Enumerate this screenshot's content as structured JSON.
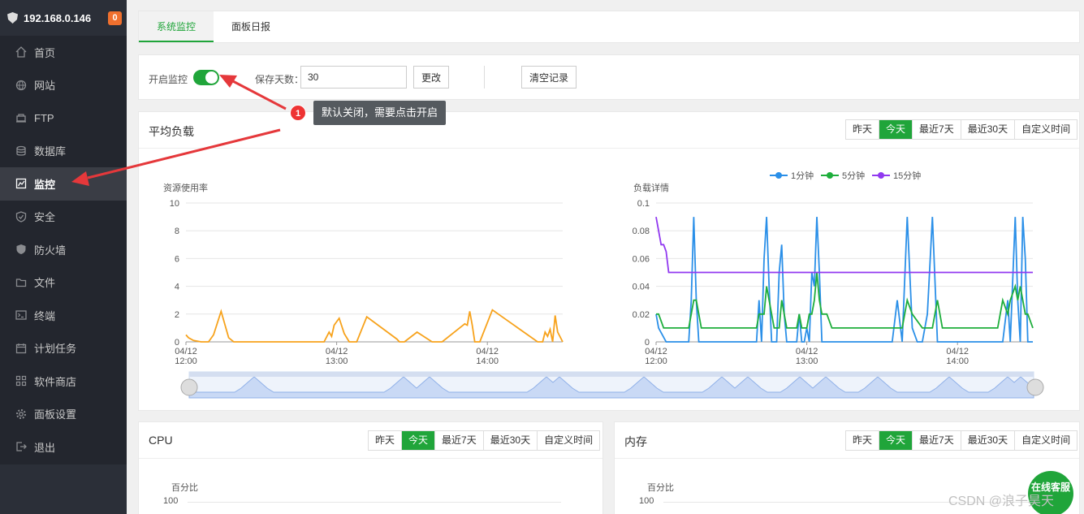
{
  "sidebar": {
    "host": "192.168.0.146",
    "badge": "0",
    "items": [
      {
        "label": "首页",
        "icon": "home-icon"
      },
      {
        "label": "网站",
        "icon": "globe-icon"
      },
      {
        "label": "FTP",
        "icon": "ftp-icon"
      },
      {
        "label": "数据库",
        "icon": "database-icon"
      },
      {
        "label": "监控",
        "icon": "monitor-icon",
        "active": true
      },
      {
        "label": "安全",
        "icon": "shield-check-icon"
      },
      {
        "label": "防火墙",
        "icon": "firewall-icon"
      },
      {
        "label": "文件",
        "icon": "folder-icon"
      },
      {
        "label": "终端",
        "icon": "terminal-icon"
      },
      {
        "label": "计划任务",
        "icon": "calendar-icon"
      },
      {
        "label": "软件商店",
        "icon": "grid-icon"
      },
      {
        "label": "面板设置",
        "icon": "gear-icon"
      },
      {
        "label": "退出",
        "icon": "logout-icon"
      }
    ]
  },
  "tabs": [
    {
      "label": "系统监控",
      "active": true
    },
    {
      "label": "面板日报",
      "active": false
    }
  ],
  "controls": {
    "enable_label": "开启监控",
    "enabled": true,
    "days_label": "保存天数：",
    "days_value": "30",
    "change_button": "更改",
    "clear_button": "清空记录"
  },
  "ranges": [
    "昨天",
    "今天",
    "最近7天",
    "最近30天",
    "自定义时间"
  ],
  "active_range": "今天",
  "load_panel": {
    "title": "平均负载"
  },
  "cpu_panel": {
    "title": "CPU",
    "ylabel": "百分比",
    "ytick": "100"
  },
  "mem_panel": {
    "title": "内存",
    "ylabel": "百分比",
    "ytick": "100"
  },
  "annotation": {
    "number": "1",
    "text": "默认关闭，需要点击开启"
  },
  "online_button": "在线客服",
  "watermark": "CSDN @浪子昊天",
  "colors": {
    "accent": "#20a53a",
    "orange": "#f7a21b",
    "blue": "#2a8fe8",
    "green": "#1eae3c",
    "purple": "#9139f0",
    "arrow": "#e5383b"
  },
  "chart_data": [
    {
      "type": "line",
      "ylabel": "资源使用率",
      "ylim": [
        0,
        10
      ],
      "yticks": [
        "0",
        "2",
        "4",
        "6",
        "8",
        "10"
      ],
      "xticks": [
        "04/12\n12:00",
        "04/12\n13:00",
        "04/12\n14:00"
      ],
      "x_range_minutes": [
        0,
        150
      ],
      "series": [
        {
          "color": "#f7a21b",
          "x": [
            0,
            1,
            3,
            6,
            9,
            11,
            14,
            17,
            19,
            22,
            26,
            33,
            38,
            39,
            40,
            41,
            42,
            44,
            46,
            55,
            57,
            58,
            59,
            61,
            63,
            65,
            68,
            72,
            84,
            85,
            87,
            92,
            98,
            102,
            111,
            112,
            113,
            114,
            115,
            117,
            122,
            140,
            142,
            143,
            144,
            145,
            146,
            147,
            148,
            150
          ],
          "y": [
            0.5,
            0.3,
            0.1,
            0,
            0,
            0.5,
            2.2,
            0.3,
            0,
            0,
            0,
            0,
            0,
            0,
            0,
            0,
            0,
            0,
            0,
            0,
            0.7,
            0.4,
            1.2,
            1.7,
            0.6,
            0,
            0,
            1.8,
            0.2,
            0,
            0,
            0.7,
            0,
            0,
            1.3,
            1.2,
            2.2,
            1.2,
            0,
            0,
            2.3,
            0,
            0,
            0.7,
            0.4,
            0.9,
            0,
            1.9,
            0.7,
            0
          ]
        }
      ]
    },
    {
      "type": "line",
      "ylabel": "负载详情",
      "ylim": [
        0,
        0.1
      ],
      "yticks": [
        "0",
        "0.02",
        "0.04",
        "0.06",
        "0.08",
        "0.1"
      ],
      "xticks": [
        "04/12\n12:00",
        "04/12\n13:00",
        "04/12\n14:00"
      ],
      "x_range_minutes": [
        0,
        150
      ],
      "legend": [
        {
          "name": "1分钟",
          "color": "#2a8fe8"
        },
        {
          "name": "5分钟",
          "color": "#1eae3c"
        },
        {
          "name": "15分钟",
          "color": "#9139f0"
        }
      ],
      "series": [
        {
          "name": "1分钟",
          "color": "#2a8fe8",
          "x": [
            0,
            1,
            4,
            6,
            12,
            13,
            14,
            15,
            16,
            17,
            18,
            19,
            20,
            21,
            22,
            24,
            26,
            40,
            41,
            42,
            43,
            44,
            45,
            46,
            47,
            48,
            49,
            50,
            51,
            52,
            54,
            56,
            57,
            58,
            59,
            60,
            61,
            62,
            63,
            64,
            65,
            66,
            67,
            70,
            72,
            74,
            76,
            78,
            80,
            82,
            84,
            92,
            94,
            96,
            98,
            100,
            102,
            104,
            106,
            108,
            110,
            112,
            114,
            116,
            118,
            120,
            122,
            124,
            126,
            128,
            130,
            136,
            138,
            140,
            141,
            143,
            144,
            145,
            146,
            147,
            148,
            150
          ],
          "y": [
            0.02,
            0.01,
            0,
            0,
            0,
            0,
            0.03,
            0.09,
            0.03,
            0,
            0,
            0,
            0,
            0,
            0,
            0,
            0,
            0,
            0.03,
            0,
            0.06,
            0.09,
            0.04,
            0,
            0,
            0,
            0.05,
            0.07,
            0.02,
            0,
            0,
            0,
            0.02,
            0,
            0,
            0.01,
            0,
            0.05,
            0.04,
            0.09,
            0.05,
            0,
            0,
            0,
            0,
            0,
            0,
            0,
            0,
            0,
            0,
            0,
            0,
            0.03,
            0,
            0.09,
            0.01,
            0,
            0,
            0.02,
            0.09,
            0,
            0,
            0,
            0,
            0,
            0,
            0,
            0,
            0,
            0,
            0,
            0,
            0.03,
            0,
            0.09,
            0.03,
            0,
            0.09,
            0.06,
            0,
            0
          ]
        },
        {
          "name": "5分钟",
          "color": "#1eae3c",
          "x": [
            0,
            1,
            3,
            6,
            8,
            12,
            13,
            14,
            15,
            16,
            17,
            18,
            20,
            24,
            28,
            34,
            40,
            41,
            43,
            44,
            45,
            46,
            47,
            49,
            50,
            51,
            52,
            54,
            56,
            57,
            58,
            60,
            61,
            62,
            63,
            64,
            65,
            66,
            68,
            70,
            74,
            80,
            88,
            92,
            96,
            98,
            100,
            102,
            106,
            110,
            112,
            114,
            116,
            120,
            124,
            130,
            136,
            138,
            140,
            141,
            143,
            144,
            145,
            146,
            147,
            148,
            150
          ],
          "y": [
            0.02,
            0.02,
            0.01,
            0.01,
            0.01,
            0.01,
            0.01,
            0.02,
            0.03,
            0.03,
            0.02,
            0.01,
            0.01,
            0.01,
            0.01,
            0.01,
            0.01,
            0.02,
            0.02,
            0.04,
            0.03,
            0.02,
            0.01,
            0.01,
            0.03,
            0.02,
            0.01,
            0.01,
            0.01,
            0.02,
            0.01,
            0.01,
            0.02,
            0.02,
            0.03,
            0.05,
            0.03,
            0.02,
            0.02,
            0.01,
            0.01,
            0.01,
            0.01,
            0.01,
            0.01,
            0.01,
            0.03,
            0.02,
            0.01,
            0.01,
            0.03,
            0.01,
            0.01,
            0.01,
            0.01,
            0.01,
            0.01,
            0.03,
            0.02,
            0.03,
            0.04,
            0.03,
            0.04,
            0.03,
            0.02,
            0.02,
            0.01
          ]
        },
        {
          "name": "15分钟",
          "color": "#9139f0",
          "x": [
            0,
            1,
            2,
            3,
            4,
            5,
            6,
            150
          ],
          "y": [
            0.09,
            0.08,
            0.07,
            0.07,
            0.065,
            0.05,
            0.05,
            0.05
          ]
        }
      ]
    }
  ]
}
